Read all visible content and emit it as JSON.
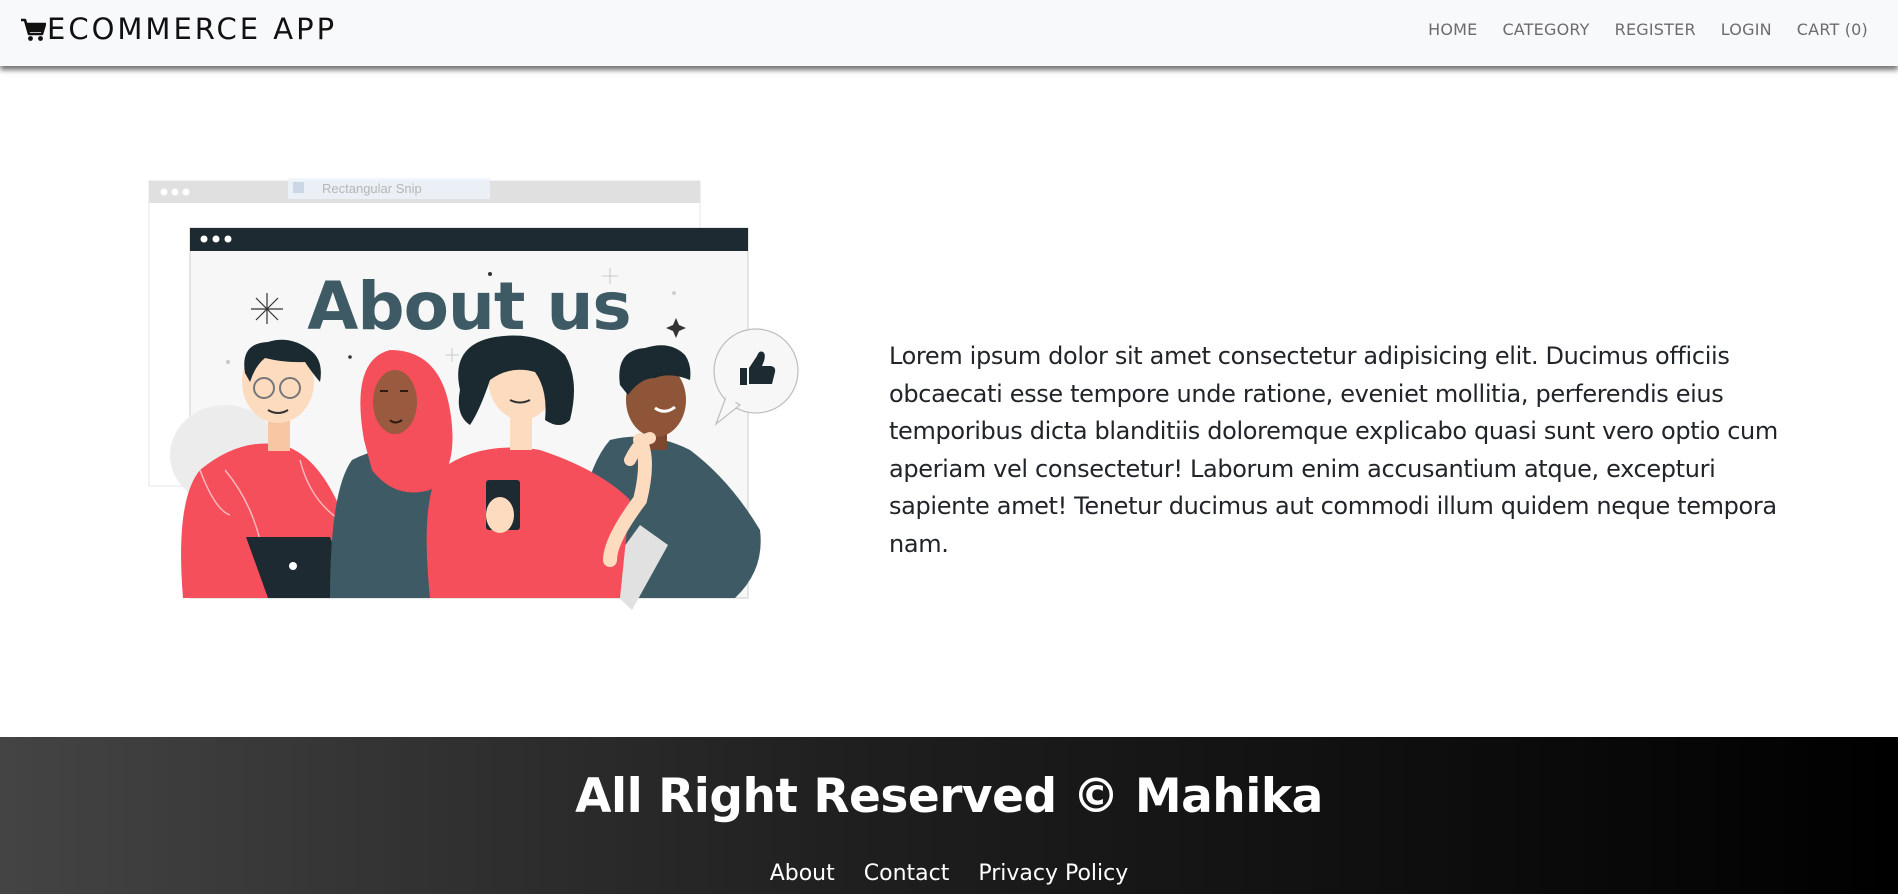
{
  "navbar": {
    "brand": "ECOMMERCE APP",
    "brand_icon": "cart-icon",
    "links": [
      "HOME",
      "CATEGORY",
      "REGISTER",
      "LOGIN",
      "CART (0)"
    ]
  },
  "about": {
    "image": {
      "title": "About us",
      "snip_label": "Rectangular Snip",
      "icons": [
        "thumbs-up-icon"
      ]
    },
    "text": "Lorem ipsum dolor sit amet consectetur adipisicing elit. Ducimus officiis obcaecati esse tempore unde ratione, eveniet mollitia, perferendis eius temporibus dicta blanditiis doloremque explicabo quasi sunt vero optio cum aperiam vel consectetur! Laborum enim accusantium atque, excepturi sapiente amet! Tenetur ducimus aut commodi illum quidem neque tempora nam."
  },
  "footer": {
    "title": "All Right Reserved © Mahika",
    "links": [
      "About",
      "Contact",
      "Privacy Policy"
    ]
  },
  "colors": {
    "navbar_bg": "#f8f9fa",
    "illustration_red": "#f44f5a",
    "illustration_teal": "#3e5b65",
    "footer_gradient_start": "#444444",
    "footer_gradient_end": "#000000"
  }
}
